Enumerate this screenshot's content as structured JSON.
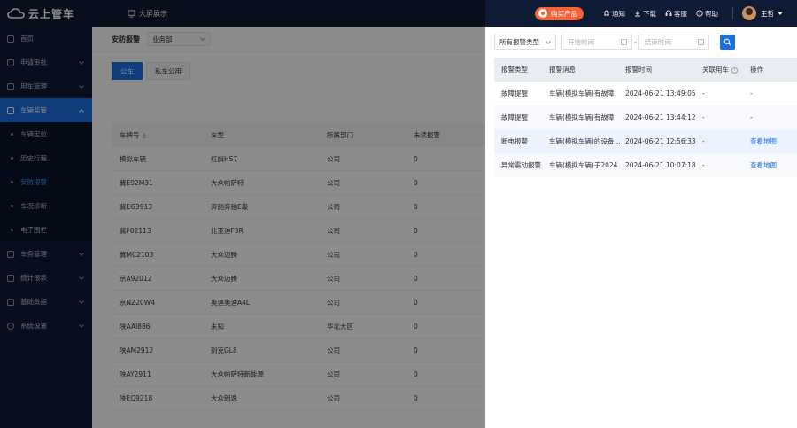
{
  "header": {
    "logo_text": "云上管车",
    "bigscreen_label": "大屏展示",
    "buy_label": "购买产品",
    "notify_label": "通知",
    "download_label": "下载",
    "service_label": "客服",
    "help_label": "帮助",
    "user_name": "王哲"
  },
  "sidebar": {
    "items": [
      {
        "label": "首页"
      },
      {
        "label": "申请审批"
      },
      {
        "label": "用车管理"
      },
      {
        "label": "车辆监管"
      },
      {
        "label": "车务管理"
      },
      {
        "label": "统计报表"
      },
      {
        "label": "基础数据"
      },
      {
        "label": "系统设置"
      }
    ],
    "sub_items": [
      {
        "label": "车辆定位"
      },
      {
        "label": "历史行程"
      },
      {
        "label": "安防报警"
      },
      {
        "label": "车况诊断"
      },
      {
        "label": "电子围栏"
      }
    ]
  },
  "main": {
    "title": "安防报警",
    "dept_select": "业务部",
    "tabs": [
      {
        "label": "公车"
      },
      {
        "label": "私车公用"
      }
    ],
    "columns": [
      "车牌号",
      "车型",
      "所属部门",
      "未读报警"
    ],
    "rows": [
      [
        "模拟车辆",
        "红旗HS7",
        "公司",
        "0"
      ],
      [
        "冀E92M31",
        "大众帕萨特",
        "公司",
        "0"
      ],
      [
        "冀EG3913",
        "奔驰奔驰E级",
        "公司",
        "0"
      ],
      [
        "冀F02113",
        "比亚迪F3R",
        "公司",
        "0"
      ],
      [
        "冀MC2103",
        "大众迈腾",
        "公司",
        "0"
      ],
      [
        "京A92012",
        "大众迈腾",
        "公司",
        "0"
      ],
      [
        "京NZ20W4",
        "奥迪奥迪A4L",
        "公司",
        "0"
      ],
      [
        "陕AAI886",
        "未知",
        "华北大区",
        "0"
      ],
      [
        "陕AM2912",
        "别克GL8",
        "公司",
        "0"
      ],
      [
        "陕AY2911",
        "大众帕萨特新能源",
        "公司",
        "0"
      ],
      [
        "陕EQ9218",
        "大众朗逸",
        "公司",
        "0"
      ]
    ]
  },
  "drawer": {
    "type_select": "所有报警类型",
    "start_placeholder": "开始时间",
    "end_placeholder": "结束时间",
    "range_sep": "-",
    "columns": [
      "报警类型",
      "报警消息",
      "报警时间",
      "关联用车",
      "操作"
    ],
    "rows": [
      [
        "故障提醒",
        "车辆(模拟车辆)有故障",
        "2024-06-21 13:49:05",
        "-",
        "-"
      ],
      [
        "故障提醒",
        "车辆(模拟车辆)有故障",
        "2024-06-21 13:44:12",
        "-",
        "-"
      ],
      [
        "断电报警",
        "车辆(模拟车辆)的设备断电",
        "2024-06-21 12:56:33",
        "-",
        "查看地图"
      ],
      [
        "异常震动报警",
        "车辆(模拟车辆)于2024",
        "2024-06-21 10:07:18",
        "-",
        "查看地图"
      ]
    ]
  }
}
